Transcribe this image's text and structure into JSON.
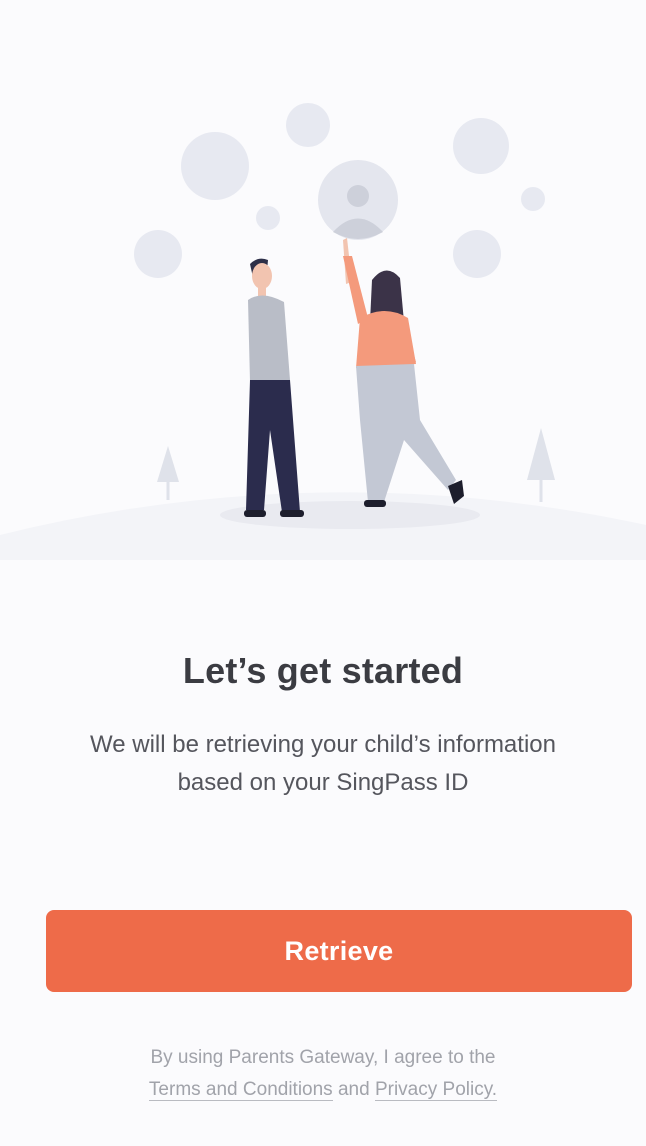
{
  "onboarding": {
    "title": "Let’s get started",
    "description": "We will be retrieving your child’s information based on your SingPass ID",
    "retrieve_label": "Retrieve",
    "legal_prefix": "By using Parents Gateway, I agree to the",
    "terms_link": "Terms and Conditions",
    "legal_and": "and",
    "privacy_link": "Privacy Policy."
  },
  "colors": {
    "accent": "#ee6b49",
    "background": "#fbfbfd",
    "hill": "#f3f4f8",
    "bubble": "#e6e8f0",
    "title_text": "#3b3c42",
    "body_text": "#55565d",
    "legal_text": "#a1a3aa"
  },
  "icons": {
    "profile_bubble": "user-avatar-icon",
    "trees": "tree-icon"
  }
}
